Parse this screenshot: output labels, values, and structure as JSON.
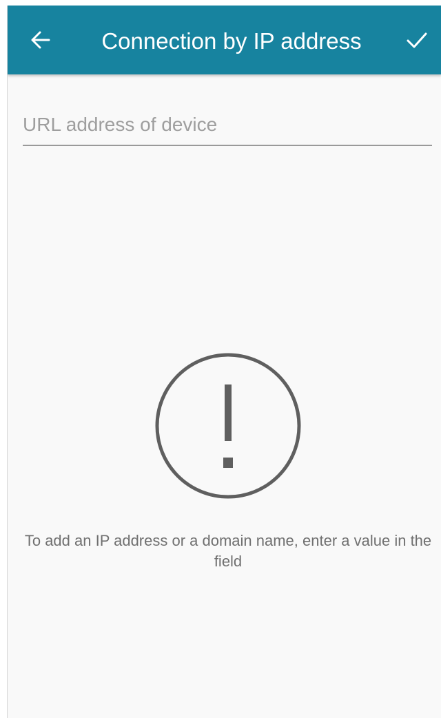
{
  "appbar": {
    "title": "Connection by IP address",
    "back_icon": "arrow-left-icon",
    "confirm_icon": "check-icon",
    "color": "#17839f"
  },
  "form": {
    "url_field": {
      "value": "",
      "placeholder": "URL address of device"
    }
  },
  "empty_state": {
    "icon": "exclamation-circle-icon",
    "message": "To add an IP address or a domain name, enter a value in the field"
  }
}
